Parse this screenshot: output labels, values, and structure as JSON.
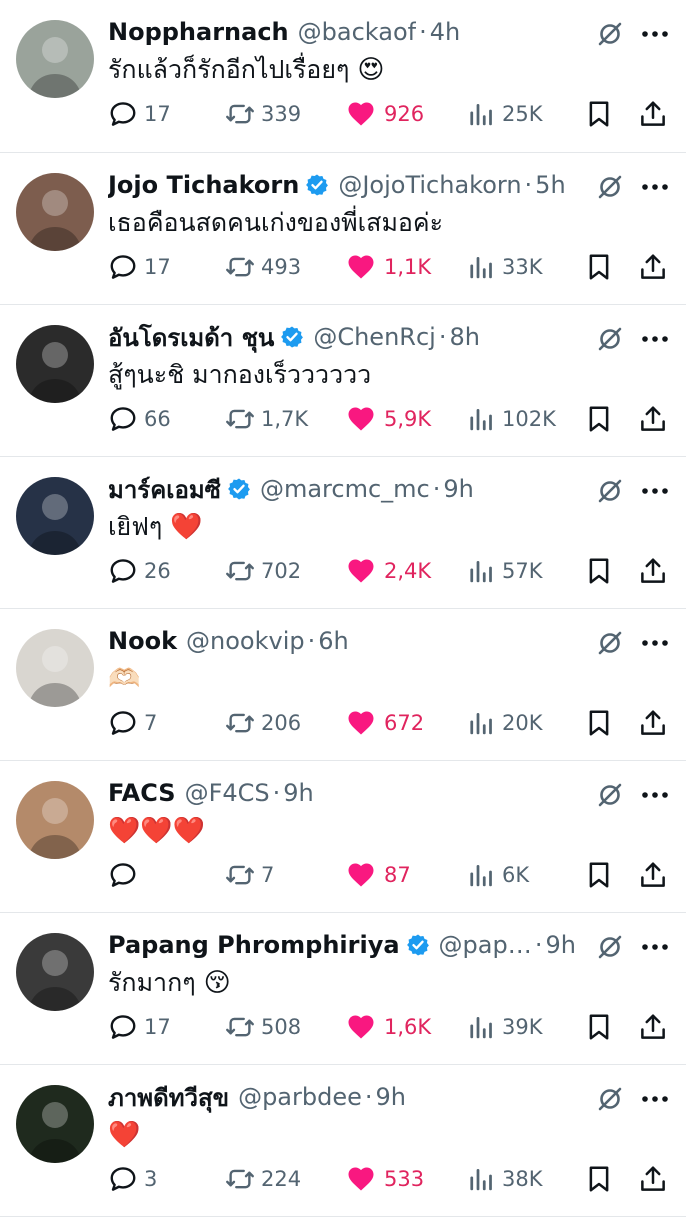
{
  "colors": {
    "like_pink": "#f91880",
    "text_primary": "#0f1419",
    "text_secondary": "#536471",
    "verified_blue": "#1d9bf0",
    "divider": "#e4e7ea"
  },
  "tweets": [
    {
      "name": "Noppharnach",
      "verified": false,
      "handle": "@backaof",
      "time": "4h",
      "text": "รักแล้วก็รักอีกไปเรื่อยๆ",
      "emoji": "😍",
      "replies": "17",
      "retweets": "339",
      "likes": "926",
      "views": "25K",
      "avatar_color": "#9aa39b"
    },
    {
      "name": "Jojo Tichakorn",
      "verified": true,
      "handle": "@JojoTichakorn",
      "time": "5h",
      "text": "เธอคือนสดคนเก่งของพี่เสมอค่ะ",
      "emoji": "",
      "replies": "17",
      "retweets": "493",
      "likes": "1,1K",
      "views": "33K",
      "avatar_color": "#7d5d4e"
    },
    {
      "name": "อันโดรเมด้า ชุน",
      "verified": true,
      "handle": "@ChenRcj",
      "time": "8h",
      "text": "สู้ๆนะชิ มากองเร็วววววว",
      "emoji": "",
      "replies": "66",
      "retweets": "1,7K",
      "likes": "5,9K",
      "views": "102K",
      "avatar_color": "#2b2b2b"
    },
    {
      "name": "มาร์คเอมซี",
      "verified": true,
      "handle": "@marcmc_mc",
      "time": "9h",
      "text": "เยิฟๆ",
      "emoji": "❤️",
      "replies": "26",
      "retweets": "702",
      "likes": "2,4K",
      "views": "57K",
      "avatar_color": "#263247"
    },
    {
      "name": "Nook",
      "verified": false,
      "handle": "@nookvip",
      "time": "6h",
      "text": "",
      "emoji": "🫶🏻",
      "replies": "7",
      "retweets": "206",
      "likes": "672",
      "views": "20K",
      "avatar_color": "#d9d6d0"
    },
    {
      "name": "FACS",
      "verified": false,
      "handle": "@F4CS",
      "time": "9h",
      "text": "",
      "emoji": "❤️❤️❤️",
      "replies": "",
      "retweets": "7",
      "likes": "87",
      "views": "6K",
      "avatar_color": "#b48a6a"
    },
    {
      "name": "Papang Phromphiriya",
      "verified": true,
      "handle": "@papan...",
      "time": "9h",
      "text": "รักมากๆ",
      "emoji": "😚",
      "replies": "17",
      "retweets": "508",
      "likes": "1,6K",
      "views": "39K",
      "avatar_color": "#3a3a3a"
    },
    {
      "name": "ภาพดีทวีสุข",
      "verified": false,
      "handle": "@parbdee",
      "time": "9h",
      "text": "",
      "emoji": "❤️",
      "replies": "3",
      "retweets": "224",
      "likes": "533",
      "views": "38K",
      "avatar_color": "#1f2a1e"
    }
  ]
}
